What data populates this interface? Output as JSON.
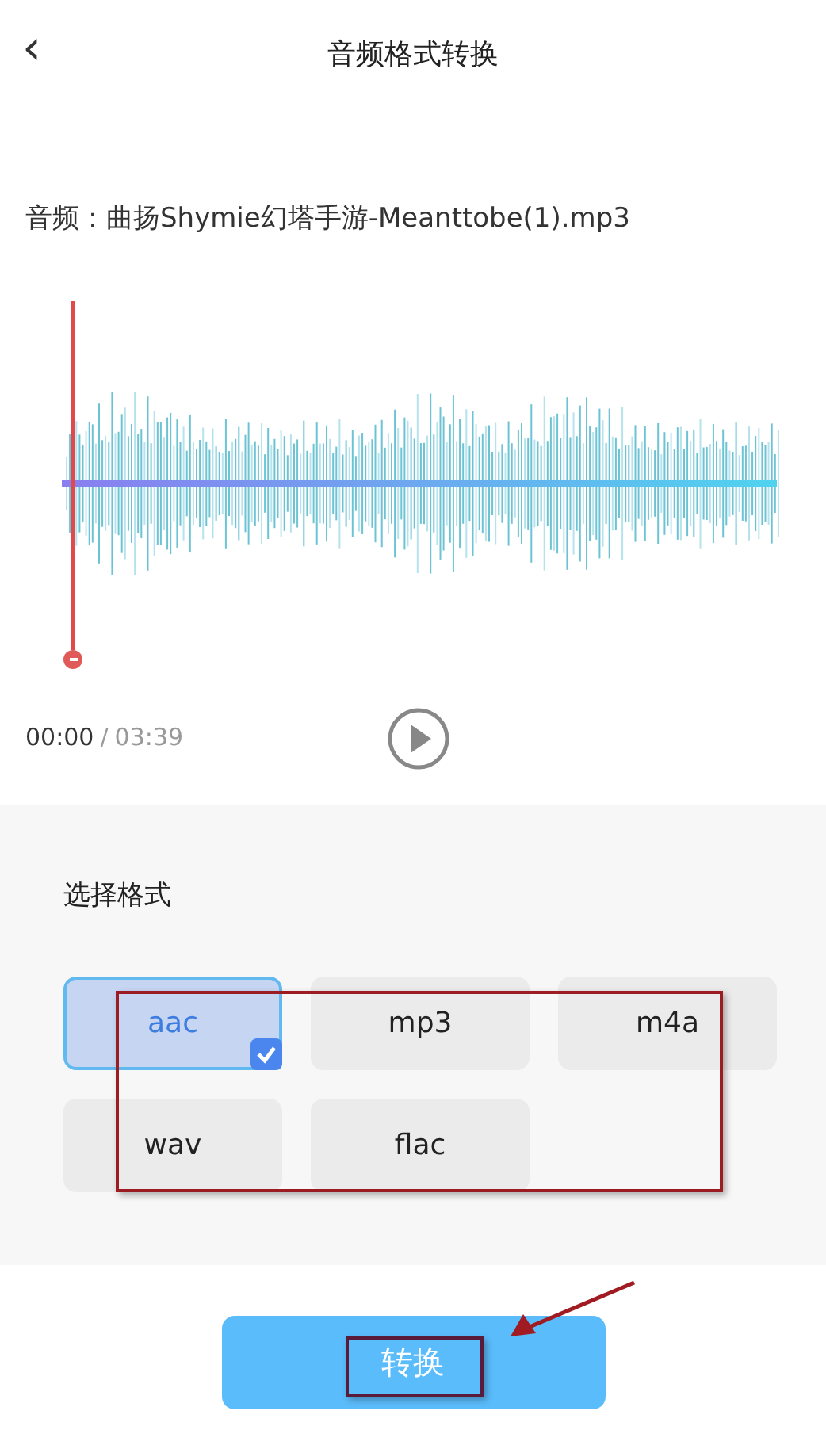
{
  "header": {
    "back": "‹",
    "title": "音频格式转换"
  },
  "file": {
    "label": "音频：曲扬Shymie幻塔手游-Meanttobe(1).mp3"
  },
  "waveform": {
    "playhead": {
      "level": 0
    }
  },
  "time": {
    "current": "00:00",
    "separator": "/",
    "total": "03:39"
  },
  "format_panel": {
    "title": "选择格式",
    "options": [
      {
        "label": "aac",
        "selected": true
      },
      {
        "label": "mp3",
        "selected": false
      },
      {
        "label": "m4a",
        "selected": false
      },
      {
        "label": "wav",
        "selected": false
      },
      {
        "label": "flac",
        "selected": false
      }
    ]
  },
  "convert_button": {
    "label": "转换"
  }
}
